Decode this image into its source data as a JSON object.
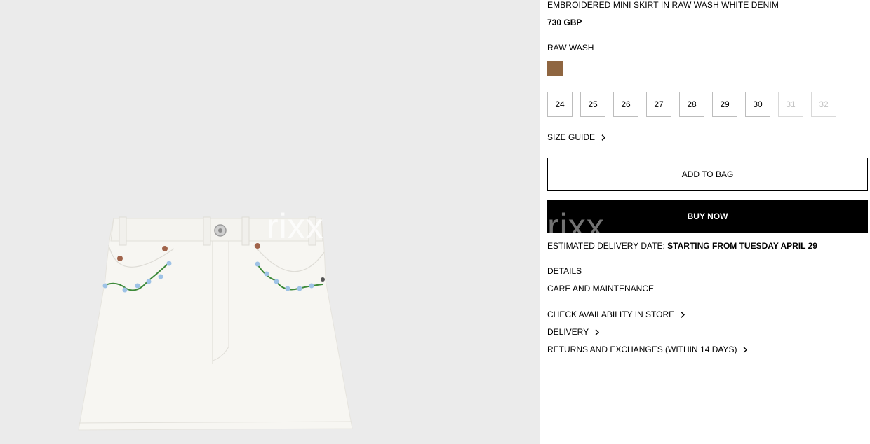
{
  "product": {
    "title": "EMBROIDERED MINI SKIRT IN RAW WASH WHITE DENIM",
    "price": "730 GBP",
    "color_label": "RAW WASH",
    "swatch_color": "#8f6641",
    "image_alt": "Embroidered white denim mini skirt"
  },
  "watermark": "rixx",
  "sizes": [
    {
      "label": "24",
      "available": true
    },
    {
      "label": "25",
      "available": true
    },
    {
      "label": "26",
      "available": true
    },
    {
      "label": "27",
      "available": true
    },
    {
      "label": "28",
      "available": true
    },
    {
      "label": "29",
      "available": true
    },
    {
      "label": "30",
      "available": true
    },
    {
      "label": "31",
      "available": false
    },
    {
      "label": "32",
      "available": false
    }
  ],
  "size_guide": "SIZE GUIDE",
  "actions": {
    "add_to_bag": "ADD TO BAG",
    "buy_now": "BUY NOW"
  },
  "delivery": {
    "label": "ESTIMATED DELIVERY DATE:",
    "date": "STARTING FROM TUESDAY APRIL 29"
  },
  "sections": {
    "details": "DETAILS",
    "care": "CARE AND MAINTENANCE",
    "check_store": "CHECK AVAILABILITY IN STORE",
    "delivery": "DELIVERY",
    "returns": "RETURNS AND EXCHANGES (WITHIN 14 DAYS)"
  }
}
